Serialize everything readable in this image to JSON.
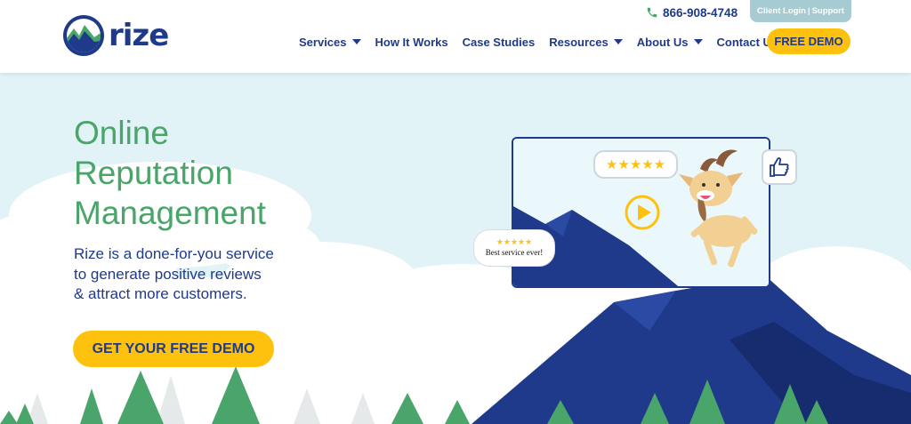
{
  "header": {
    "logo_text": "rize",
    "phone": "866-908-4748",
    "client_login": "Client Login",
    "separator": "|",
    "support": "Support",
    "nav": [
      {
        "label": "Services",
        "dropdown": true
      },
      {
        "label": "How It Works",
        "dropdown": false
      },
      {
        "label": "Case Studies",
        "dropdown": false
      },
      {
        "label": "Resources",
        "dropdown": true
      },
      {
        "label": "About Us",
        "dropdown": true
      },
      {
        "label": "Contact Us",
        "dropdown": false
      }
    ],
    "demo_button": "FREE DEMO"
  },
  "hero": {
    "title_lines": [
      "Online",
      "Reputation",
      "Management"
    ],
    "subtitle_lines": [
      "Rize is a done-for-you service",
      "to generate positive reviews",
      "& attract more customers."
    ],
    "cta": "GET YOUR FREE DEMO",
    "review_stars": "★★★★★",
    "quote_stars": "★★★★★",
    "quote_text": "Best service ever!"
  },
  "colors": {
    "brand_blue": "#1f3a8a",
    "brand_green": "#4aa56a",
    "cta_yellow": "#fec20e",
    "sky": "#e2f3f8",
    "tab_blue": "#a7cbd3"
  },
  "icons": [
    "rize-logo-icon",
    "phone-icon",
    "dropdown-caret-icon",
    "play-icon",
    "goat-mascot-icon",
    "thumbs-up-icon",
    "star-icon"
  ]
}
